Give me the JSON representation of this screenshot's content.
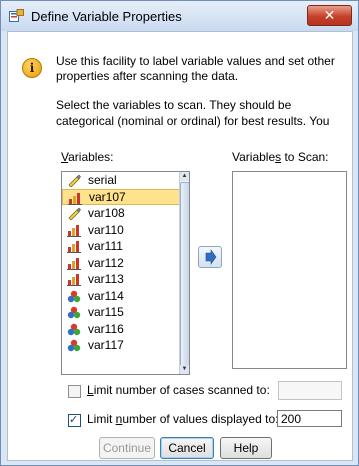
{
  "window": {
    "title": "Define Variable Properties",
    "close_label": "✕"
  },
  "intro": {
    "icon": "info-icon",
    "text": "Use this facility to label variable values and set other properties after scanning the data."
  },
  "select_text": "Select the variables to scan. They should be categorical (nominal or ordinal) for best results. You",
  "variables": {
    "label_prefix": "V",
    "label_rest": "ariables:",
    "items": [
      {
        "name": "serial",
        "type": "string"
      },
      {
        "name": "var107",
        "type": "scale"
      },
      {
        "name": "var108",
        "type": "string"
      },
      {
        "name": "var110",
        "type": "scale"
      },
      {
        "name": "var111",
        "type": "scale"
      },
      {
        "name": "var112",
        "type": "scale"
      },
      {
        "name": "var113",
        "type": "scale"
      },
      {
        "name": "var114",
        "type": "nominal"
      },
      {
        "name": "var115",
        "type": "nominal"
      },
      {
        "name": "var116",
        "type": "nominal"
      },
      {
        "name": "var117",
        "type": "nominal"
      }
    ],
    "selected": "var107"
  },
  "scan": {
    "label_a": "Variable",
    "label_u": "s",
    "label_b": " to Scan:"
  },
  "options": {
    "limit_cases": {
      "label_u": "L",
      "label_rest": "imit number of cases scanned to:",
      "checked": false,
      "value": ""
    },
    "limit_values": {
      "label_a": "Limit ",
      "label_u": "n",
      "label_b": "umber of values displayed to:",
      "checked": true,
      "value": "200"
    }
  },
  "buttons": {
    "continue": "Continue",
    "cancel": "Cancel",
    "help": "Help"
  }
}
